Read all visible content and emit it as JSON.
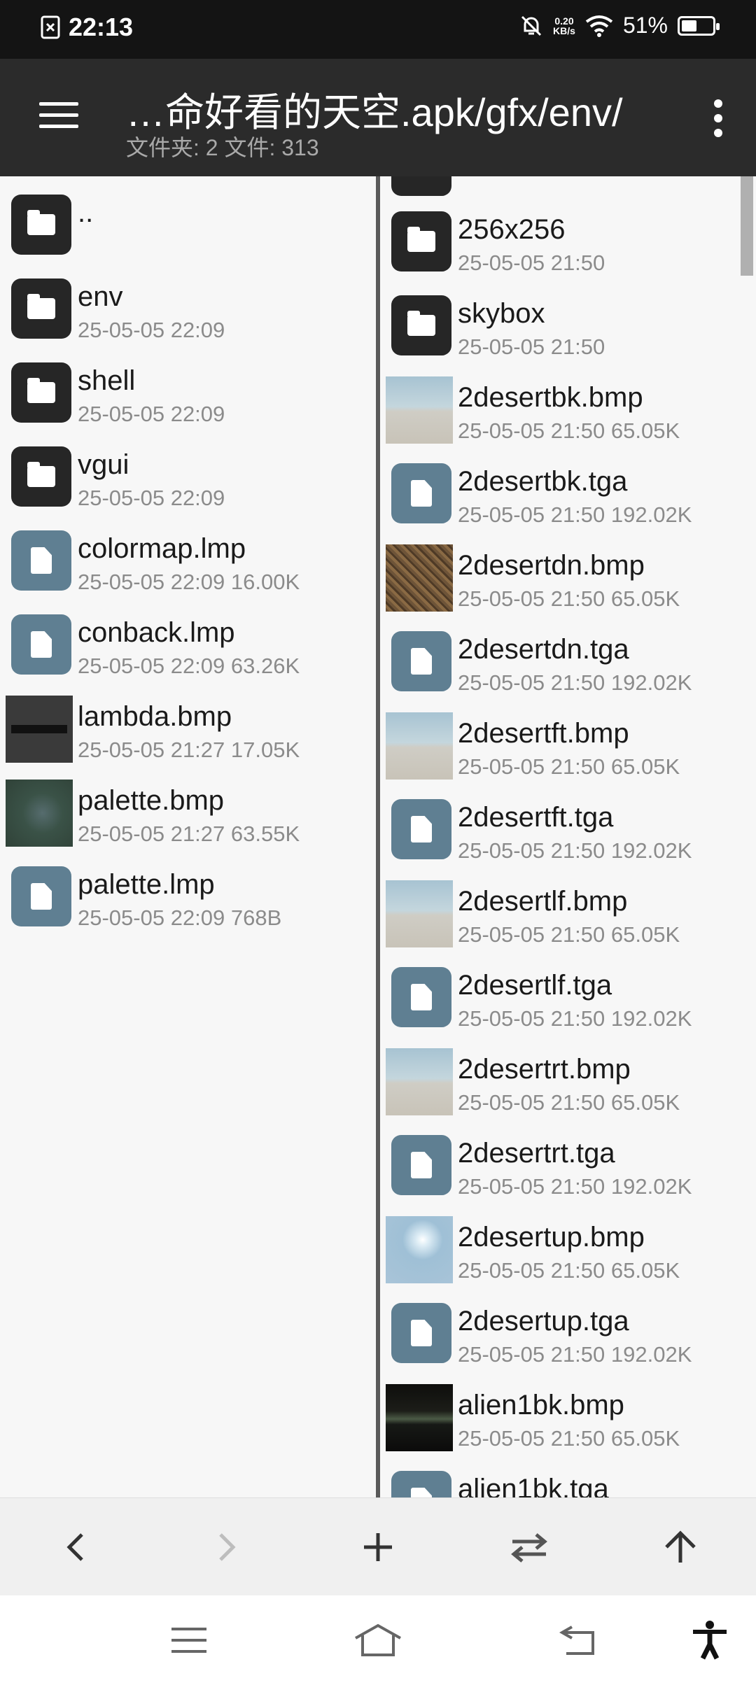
{
  "status_bar": {
    "time": "22:13",
    "net_speed_value": "0.20",
    "net_speed_unit": "KB/s",
    "battery": "51%",
    "battery_level": 0.51
  },
  "toolbar": {
    "path": "…命好看的天空.apk/gfx/env/",
    "summary": "文件夹: 2  文件: 313"
  },
  "left_pane": {
    "items": [
      {
        "name": "..",
        "meta": "",
        "type": "folder"
      },
      {
        "name": "env",
        "meta": "25-05-05 22:09",
        "type": "folder"
      },
      {
        "name": "shell",
        "meta": "25-05-05 22:09",
        "type": "folder"
      },
      {
        "name": "vgui",
        "meta": "25-05-05 22:09",
        "type": "folder"
      },
      {
        "name": "colormap.lmp",
        "meta": "25-05-05 22:09  16.00K",
        "type": "file"
      },
      {
        "name": "conback.lmp",
        "meta": "25-05-05 22:09  63.26K",
        "type": "file"
      },
      {
        "name": "lambda.bmp",
        "meta": "25-05-05 21:27  17.05K",
        "type": "image-dark"
      },
      {
        "name": "palette.bmp",
        "meta": "25-05-05 21:27  63.55K",
        "type": "image-green"
      },
      {
        "name": "palette.lmp",
        "meta": "25-05-05 22:09  768B",
        "type": "file"
      }
    ]
  },
  "right_pane": {
    "items": [
      {
        "name": "256x256",
        "meta": "25-05-05 21:50",
        "type": "folder"
      },
      {
        "name": "skybox",
        "meta": "25-05-05 21:50",
        "type": "folder"
      },
      {
        "name": "2desertbk.bmp",
        "meta": "25-05-05 21:50  65.05K",
        "type": "image-sky"
      },
      {
        "name": "2desertbk.tga",
        "meta": "25-05-05 21:50  192.02K",
        "type": "file"
      },
      {
        "name": "2desertdn.bmp",
        "meta": "25-05-05 21:50  65.05K",
        "type": "image-dirt"
      },
      {
        "name": "2desertdn.tga",
        "meta": "25-05-05 21:50  192.02K",
        "type": "file"
      },
      {
        "name": "2desertft.bmp",
        "meta": "25-05-05 21:50  65.05K",
        "type": "image-sky"
      },
      {
        "name": "2desertft.tga",
        "meta": "25-05-05 21:50  192.02K",
        "type": "file"
      },
      {
        "name": "2desertlf.bmp",
        "meta": "25-05-05 21:50  65.05K",
        "type": "image-sky"
      },
      {
        "name": "2desertlf.tga",
        "meta": "25-05-05 21:50  192.02K",
        "type": "file"
      },
      {
        "name": "2desertrt.bmp",
        "meta": "25-05-05 21:50  65.05K",
        "type": "image-sky"
      },
      {
        "name": "2desertrt.tga",
        "meta": "25-05-05 21:50  192.02K",
        "type": "file"
      },
      {
        "name": "2desertup.bmp",
        "meta": "25-05-05 21:50  65.05K",
        "type": "image-up"
      },
      {
        "name": "2desertup.tga",
        "meta": "25-05-05 21:50  192.02K",
        "type": "file"
      },
      {
        "name": "alien1bk.bmp",
        "meta": "25-05-05 21:50  65.05K",
        "type": "image-alien"
      },
      {
        "name": "alien1bk.tga",
        "meta": "",
        "type": "file"
      }
    ]
  },
  "bottom_actions": [
    "back",
    "forward",
    "new",
    "swap-panes",
    "parent-directory"
  ],
  "colors": {
    "folder_bg": "#262626",
    "file_bg": "#5f7f92",
    "toolbar_bg": "#2b2b2b"
  }
}
